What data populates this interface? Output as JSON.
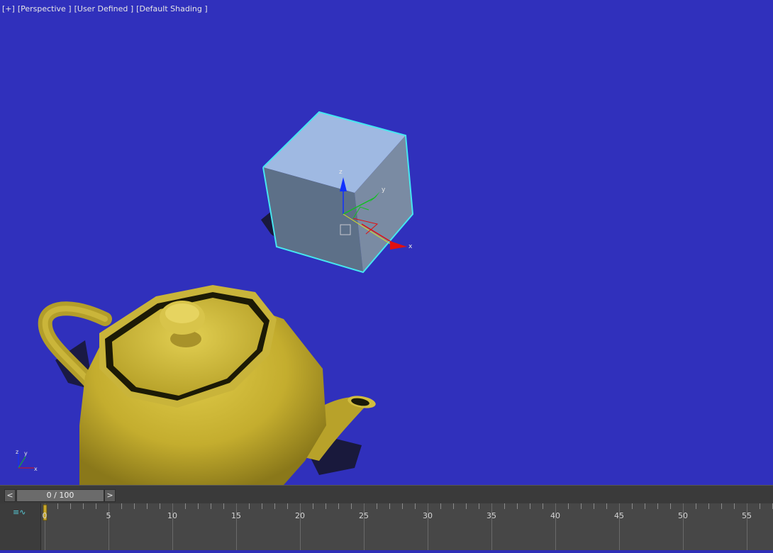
{
  "viewport": {
    "labels": [
      "[+]",
      "[Perspective ]",
      "[User Defined ]",
      "[Default Shading ]"
    ],
    "background": "#3030bc",
    "gizmo_axes": {
      "x": "x",
      "y": "y",
      "z": "z"
    },
    "corner_axes": {
      "x": "x",
      "y": "y",
      "z": "z"
    }
  },
  "timeline": {
    "prev_label": "<",
    "next_label": ">",
    "frame_display": "0 / 100",
    "ticks": [
      "0",
      "5",
      "10",
      "15",
      "20",
      "25",
      "30",
      "35",
      "40",
      "45",
      "50",
      "55"
    ]
  },
  "colors": {
    "teapot": "#c8b332",
    "cube_selection": "#46e6f0",
    "axis_x": "#e01010",
    "axis_y": "#10c020",
    "axis_z": "#1030ff"
  }
}
